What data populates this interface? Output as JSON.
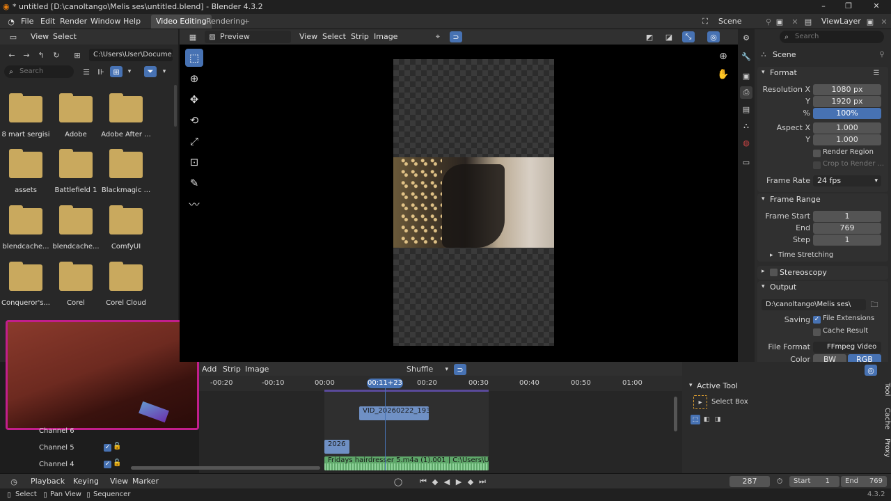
{
  "window": {
    "title": "* untitled [D:\\canoltango\\Melis ses\\untitled.blend] - Blender 4.3.2",
    "minimize": "–",
    "maximize": "❐",
    "close": "✕"
  },
  "menu": {
    "file": "File",
    "edit": "Edit",
    "render": "Render",
    "window": "Window",
    "help": "Help"
  },
  "workspaces": {
    "active": "Video Editing",
    "second": "Rendering",
    "add": "+"
  },
  "scene": {
    "name": "Scene",
    "viewlayer": "ViewLayer"
  },
  "filebrowser": {
    "view": "View",
    "select": "Select",
    "path": "C:\\Users\\User\\Docume...",
    "search_placeholder": "Search",
    "folders": [
      {
        "name": "8 mart sergisi"
      },
      {
        "name": "Adobe"
      },
      {
        "name": "Adobe After ..."
      },
      {
        "name": "assets"
      },
      {
        "name": "Battlefield 1"
      },
      {
        "name": "Blackmagic ..."
      },
      {
        "name": "blendcache..."
      },
      {
        "name": "blendcache..."
      },
      {
        "name": "ComfyUI"
      },
      {
        "name": "Conqueror's..."
      },
      {
        "name": "Corel"
      },
      {
        "name": "Corel Cloud"
      }
    ]
  },
  "preview": {
    "mode": "Preview",
    "view": "View",
    "select": "Select",
    "strip": "Strip",
    "image": "Image"
  },
  "properties": {
    "search_placeholder": "Search",
    "scene_label": "Scene",
    "format": {
      "title": "Format",
      "res_x_label": "Resolution X",
      "res_x": "1080 px",
      "res_y_label": "Y",
      "res_y": "1920 px",
      "pct_label": "%",
      "pct": "100%",
      "aspect_x_label": "Aspect X",
      "aspect_x": "1.000",
      "aspect_y_label": "Y",
      "aspect_y": "1.000",
      "render_region": "Render Region",
      "crop": "Crop to Render ...",
      "frame_rate_label": "Frame Rate",
      "frame_rate": "24 fps"
    },
    "frame_range": {
      "title": "Frame Range",
      "start_label": "Frame Start",
      "start": "1",
      "end_label": "End",
      "end": "769",
      "step_label": "Step",
      "step": "1",
      "time_stretching": "Time Stretching"
    },
    "stereoscopy": "Stereoscopy",
    "output": {
      "title": "Output",
      "path": "D:\\canoltango\\Melis ses\\",
      "saving_label": "Saving",
      "file_ext": "File Extensions",
      "cache_result": "Cache Result",
      "file_format_label": "File Format",
      "file_format": "FFmpeg Video",
      "color_label": "Color",
      "bw": "BW",
      "rgb": "RGB"
    }
  },
  "sequencer": {
    "add": "Add",
    "strip": "Strip",
    "image": "Image",
    "snap": "Shuffle",
    "ticks": [
      "-00:20",
      "-00:10",
      "00:00",
      "00:20",
      "00:30",
      "00:40",
      "00:50",
      "01:00"
    ],
    "playhead": "00:11+23",
    "strips": {
      "video": "VID_20260222_193",
      "image": "2026",
      "audio": "Fridays hairdresser 5.m4a (1).001 | C:\\Users\\User\\"
    },
    "channels": [
      "Channel 6",
      "Channel 5",
      "Channel 4"
    ]
  },
  "sidebar": {
    "active_tool": "Active Tool",
    "tool_name": "Select Box",
    "tabs": [
      "Tool",
      "Cache",
      "Proxy"
    ]
  },
  "timeline": {
    "playback": "Playback",
    "keying": "Keying",
    "view": "View",
    "marker": "Marker",
    "current_frame": "287",
    "start_label": "Start",
    "start": "1",
    "end_label": "End",
    "end": "769"
  },
  "statusbar": {
    "select": "Select",
    "pan": "Pan View",
    "sequencer": "Sequencer",
    "version": "4.3.2"
  }
}
